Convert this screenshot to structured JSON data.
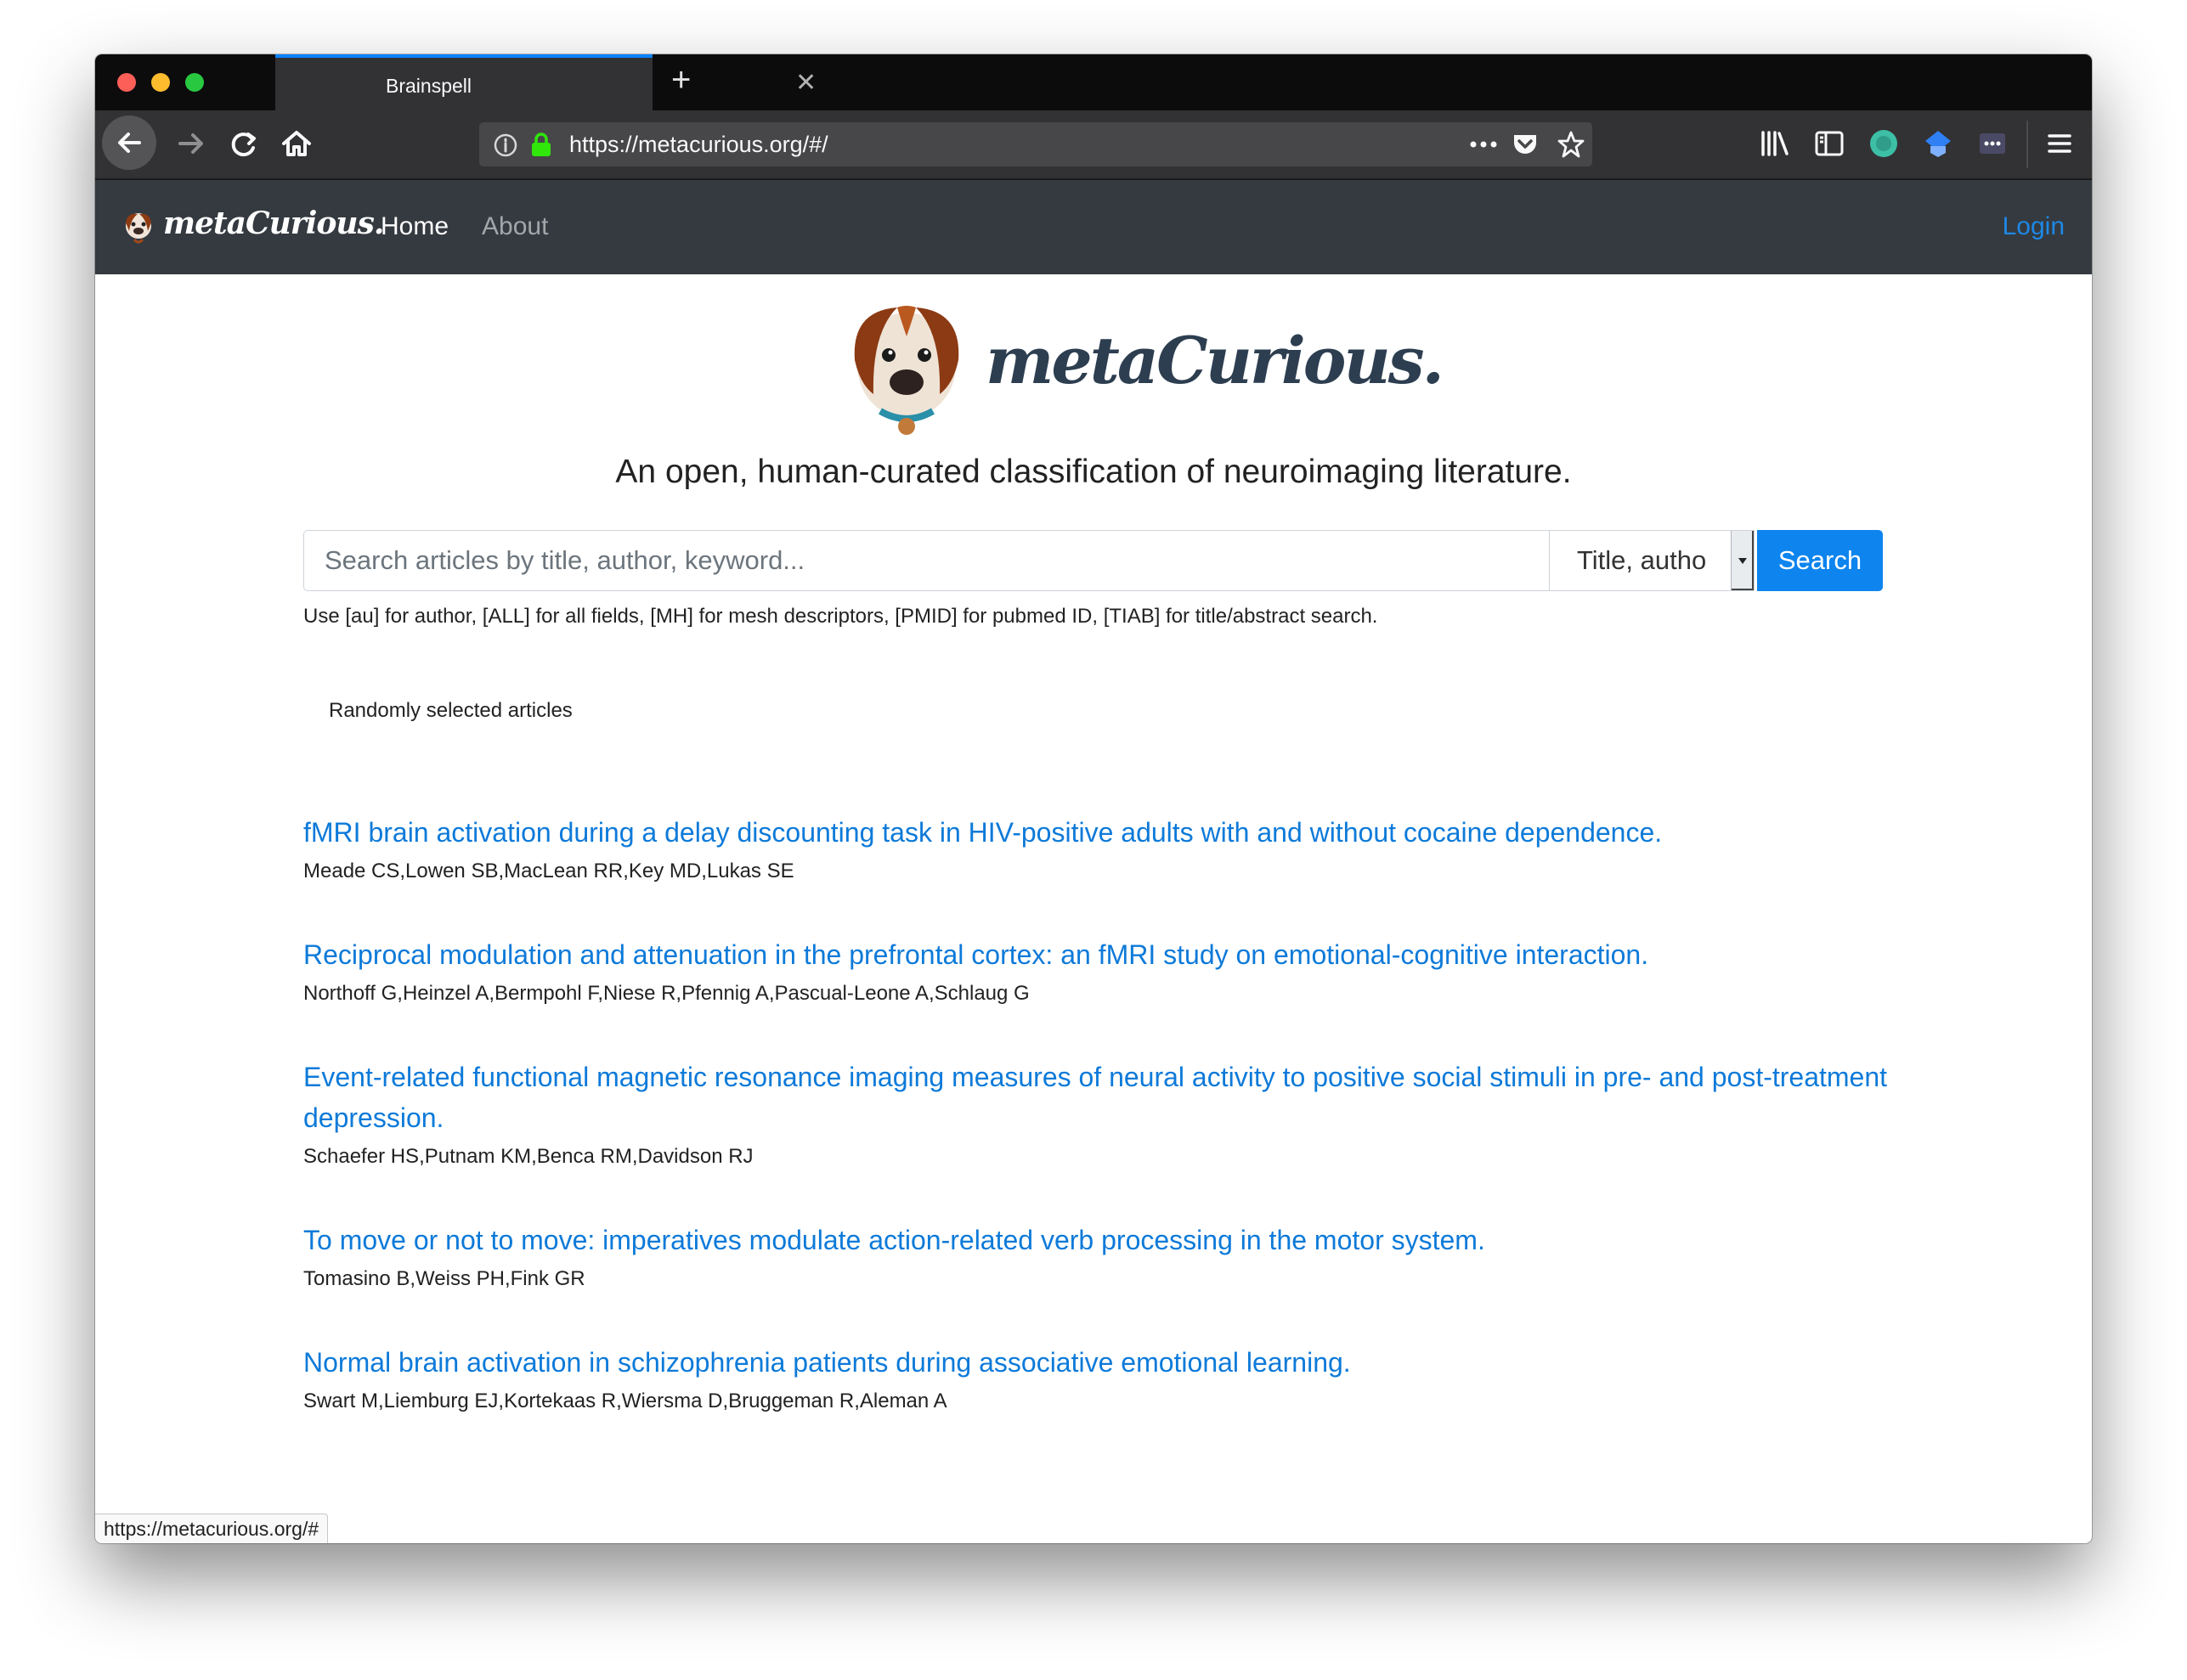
{
  "browser": {
    "tab_title": "Brainspell",
    "url": "https://metacurious.org/#/",
    "status_url": "https://metacurious.org/#"
  },
  "site": {
    "brand": "metaCurious.",
    "nav": {
      "home": "Home",
      "about": "About",
      "login": "Login"
    }
  },
  "hero": {
    "logo_text": "metaCurious.",
    "tagline": "An open, human-curated classification of neuroimaging literature."
  },
  "search": {
    "placeholder": "Search articles by title, author, keyword...",
    "field_selected": "Title, autho",
    "button": "Search",
    "help": "Use [au] for author, [ALL] for all fields, [MH] for mesh descriptors, [PMID] for pubmed ID, [TIAB] for title/abstract search."
  },
  "random": {
    "label": "Randomly selected articles",
    "articles": [
      {
        "title": "fMRI brain activation during a delay discounting task in HIV-positive adults with and without cocaine dependence.",
        "authors": "Meade CS,Lowen SB,MacLean RR,Key MD,Lukas SE"
      },
      {
        "title": "Reciprocal modulation and attenuation in the prefrontal cortex: an fMRI study on emotional-cognitive interaction.",
        "authors": "Northoff G,Heinzel A,Bermpohl F,Niese R,Pfennig A,Pascual-Leone A,Schlaug G"
      },
      {
        "title": "Event-related functional magnetic resonance imaging measures of neural activity to positive social stimuli in pre- and post-treatment depression.",
        "authors": "Schaefer HS,Putnam KM,Benca RM,Davidson RJ"
      },
      {
        "title": "To move or not to move: imperatives modulate action-related verb processing in the motor system.",
        "authors": "Tomasino B,Weiss PH,Fink GR"
      },
      {
        "title": "Normal brain activation in schizophrenia patients during associative emotional learning.",
        "authors": "Swart M,Liemburg EJ,Kortekaas R,Wiersma D,Bruggeman R,Aleman A"
      }
    ]
  },
  "colors": {
    "link": "#0d7ad9",
    "primary_button": "#0d84ee",
    "navbar": "#343a40",
    "browser_accent": "#0a84ff"
  },
  "icons": [
    "back-arrow-icon",
    "forward-arrow-icon",
    "reload-icon",
    "home-icon",
    "info-icon",
    "lock-icon",
    "more-icon",
    "pocket-icon",
    "star-icon",
    "library-icon",
    "sidebar-icon",
    "extension-icon",
    "hamburger-menu-icon",
    "dog-logo-icon"
  ]
}
